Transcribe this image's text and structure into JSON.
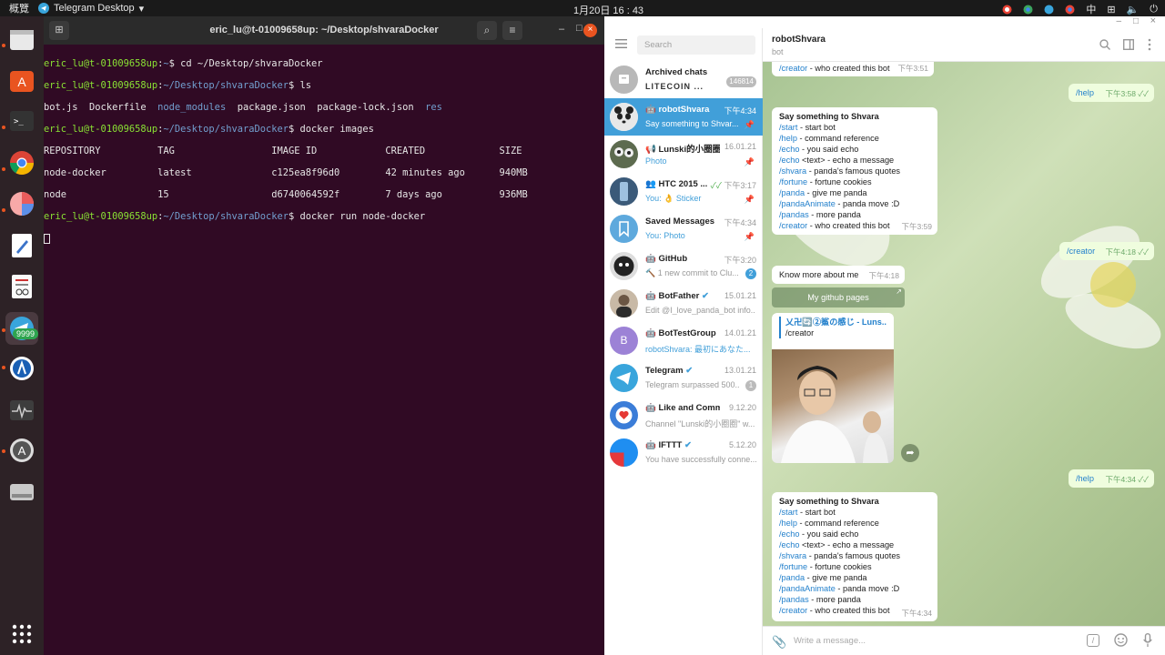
{
  "topbar": {
    "activities": "概覽",
    "app_name": "Telegram Desktop",
    "clock": "1月20日  16 : 43",
    "input_method": "中"
  },
  "dock": {
    "telegram_badge": "9999"
  },
  "terminal": {
    "title": "eric_lu@t-01009658up: ~/Desktop/shvaraDocker",
    "lines": {
      "l1_prompt": "eric_lu@t-01009658up",
      "l1_path": "~",
      "l1_cmd": "$ cd ~/Desktop/shvaraDocker",
      "l2_prompt": "eric_lu@t-01009658up",
      "l2_path": "~/Desktop/shvaraDocker",
      "l2_cmd": "$ ls",
      "l3_files": "bot.js  Dockerfile  ",
      "l3_dir1": "node_modules",
      "l3_files2": "  package.json  package-lock.json  ",
      "l3_dir2": "res",
      "l4_prompt": "eric_lu@t-01009658up",
      "l4_path": "~/Desktop/shvaraDocker",
      "l4_cmd": "$ docker images",
      "table_header": "REPOSITORY          TAG                 IMAGE ID            CREATED             SIZE",
      "row1": "node-docker         latest              c125ea8f96d0        42 minutes ago      940MB",
      "row2": "node                15                  d6740064592f        7 days ago          936MB",
      "l7_prompt": "eric_lu@t-01009658up",
      "l7_path": "~/Desktop/shvaraDocker",
      "l7_cmd": "$ docker run node-docker"
    }
  },
  "telegram": {
    "search_placeholder": "Search",
    "chats": [
      {
        "name": "Archived chats",
        "preview": "LITECOIN ...",
        "time": "",
        "badge": "146814"
      },
      {
        "name": "robotShvara",
        "preview": "Say something to Shvar...",
        "time": "下午4:34",
        "badge": ""
      },
      {
        "name": "Lunski的小圈圈",
        "preview": "Photo",
        "time": "16.01.21",
        "badge": ""
      },
      {
        "name": "HTC 2015 ...",
        "preview": "You: 👌 Sticker",
        "time": "下午3:17",
        "badge": ""
      },
      {
        "name": "Saved Messages",
        "preview": "You: Photo",
        "time": "下午4:34",
        "badge": ""
      },
      {
        "name": "GitHub",
        "preview": "🔨 1 new commit to Clu...",
        "time": "下午3:20",
        "badge": "2"
      },
      {
        "name": "BotFather",
        "preview": "Edit @I_love_panda_bot info...",
        "time": "15.01.21",
        "badge": ""
      },
      {
        "name": "BotTestGroup",
        "preview": "robotShvara: 最初にあなた...",
        "time": "14.01.21",
        "badge": ""
      },
      {
        "name": "Telegram",
        "preview": "Telegram surpassed 500...",
        "time": "13.01.21",
        "badge": "1"
      },
      {
        "name": "Like and Comm...",
        "preview": "Channel \"Lunski的小圈圈\" w...",
        "time": "9.12.20",
        "badge": ""
      },
      {
        "name": "IFTTT",
        "preview": "You have successfully conne...",
        "time": "5.12.20",
        "badge": ""
      }
    ],
    "chat_title": "robotShvara",
    "chat_status": "bot",
    "messages": {
      "m0_cmd": "/creator",
      "m0_text": " - who created this bot",
      "m0_time": "下午3:51",
      "m1_text": "/help",
      "m1_time": "下午3:58",
      "m2_title": "Say something to Shvara",
      "m2_time": "下午3:59",
      "m3_text": "/creator",
      "m3_time": "下午4:18",
      "m4_text": "Know more about me",
      "m4_time": "下午4:18",
      "m4_button": "My github pages",
      "m5_reply_name": "乂卍🔄②鯊の感じ - Luns...",
      "m5_reply_text": "/creator",
      "m6_text": "/help",
      "m6_time": "下午4:34",
      "m7_title": "Say something to Shvara",
      "m7_time": "下午4:34"
    },
    "help_lines": [
      {
        "cmd": "/start",
        "desc": " - start bot"
      },
      {
        "cmd": "/help",
        "desc": " - command reference"
      },
      {
        "cmd": "/echo",
        "desc": " - you said echo"
      },
      {
        "cmd": "/echo",
        "desc": " <text> - echo a message"
      },
      {
        "cmd": "/shvara",
        "desc": " - panda's famous quotes"
      },
      {
        "cmd": "/fortune",
        "desc": " - fortune cookies"
      },
      {
        "cmd": "/panda",
        "desc": " - give me panda"
      },
      {
        "cmd": "/pandaAnimate",
        "desc": " - panda move :D"
      },
      {
        "cmd": "/pandas",
        "desc": " - more panda"
      },
      {
        "cmd": "/creator",
        "desc": " - who created this bot"
      }
    ],
    "input_placeholder": "Write a message..."
  }
}
